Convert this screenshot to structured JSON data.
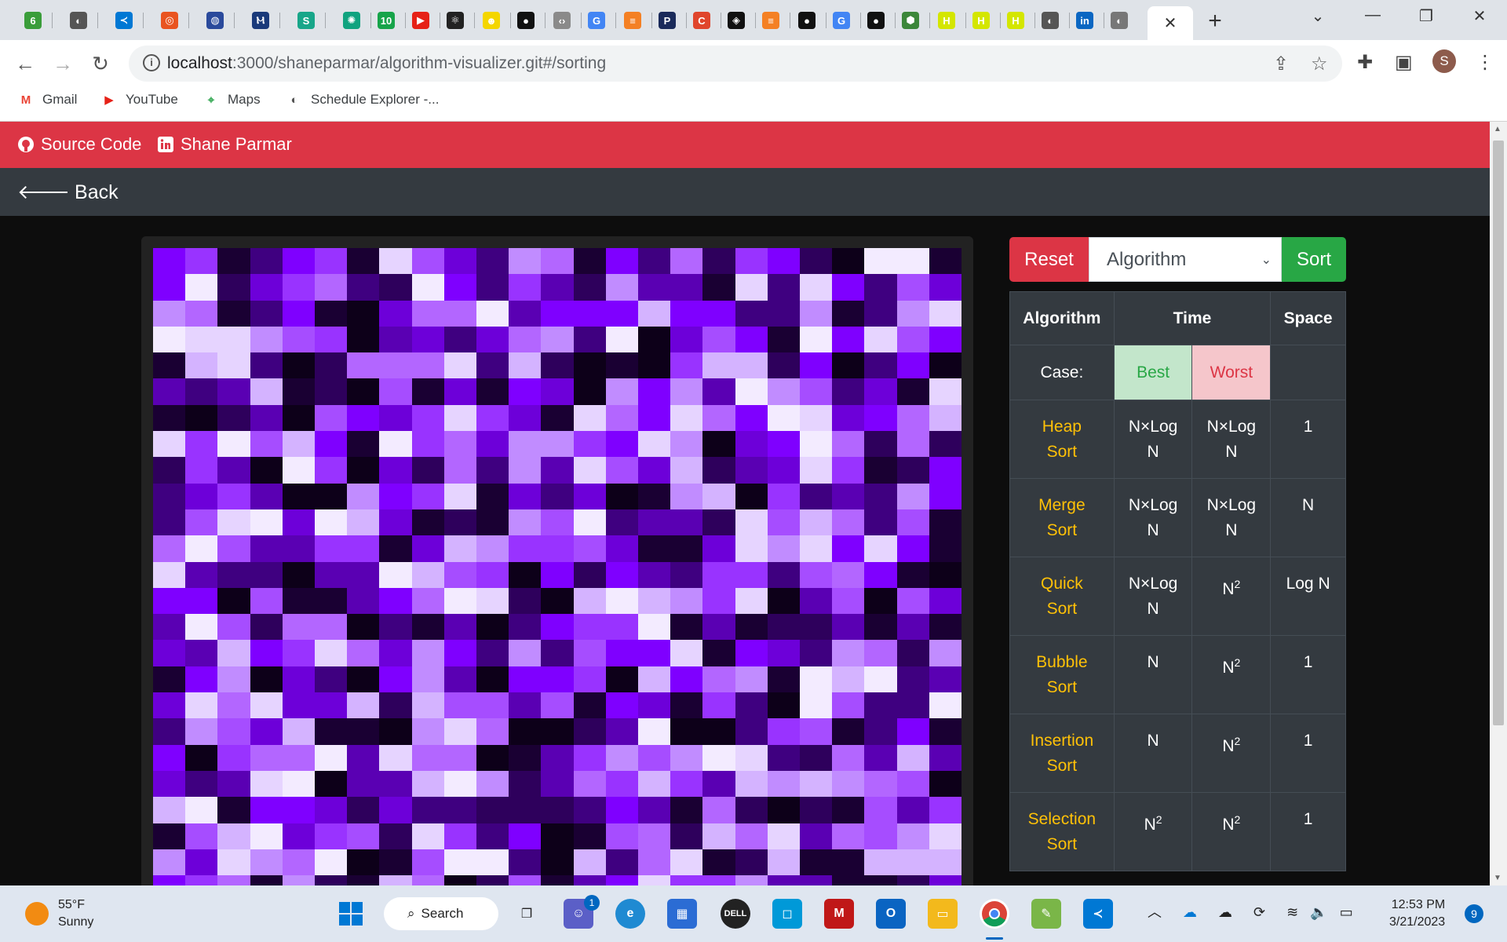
{
  "browser": {
    "tabs": [
      {
        "icon": "leaf-icon",
        "glyph": "6",
        "color": "#3a9d3a"
      },
      {
        "icon": "globe-icon",
        "glyph": "◐",
        "color": "#555555"
      },
      {
        "icon": "vscode-icon",
        "glyph": "≺",
        "color": "#0078d4"
      },
      {
        "icon": "ubuntu-icon",
        "glyph": "◎",
        "color": "#e95420"
      },
      {
        "icon": "fingerprint-icon",
        "glyph": "◍",
        "color": "#2a4a9c"
      },
      {
        "icon": "mongo-icon",
        "glyph": "Ⲙ",
        "color": "#1a3a7a"
      },
      {
        "icon": "s-logo-icon",
        "glyph": "S",
        "color": "#18a689"
      },
      {
        "icon": "chatgpt-icon",
        "glyph": "✺",
        "color": "#10a37f"
      },
      {
        "icon": "badge-10-icon",
        "glyph": "10",
        "color": "#17a44a"
      },
      {
        "icon": "youtube-icon",
        "glyph": "▶",
        "color": "#e62117"
      },
      {
        "icon": "react-icon",
        "glyph": "⚛",
        "color": "#222222"
      },
      {
        "icon": "snapchat-icon",
        "glyph": "☻",
        "color": "#f4d600"
      },
      {
        "icon": "github-icon",
        "glyph": "●",
        "color": "#111111"
      },
      {
        "icon": "code-icon",
        "glyph": "‹›",
        "color": "#8a8a8a"
      },
      {
        "icon": "google-icon",
        "glyph": "G",
        "color": "#4285f4"
      },
      {
        "icon": "stackoverflow-icon",
        "glyph": "≡",
        "color": "#f48024"
      },
      {
        "icon": "p-logo-icon",
        "glyph": "P",
        "color": "#1a2a5a"
      },
      {
        "icon": "c-logo-icon",
        "glyph": "C",
        "color": "#e0452c"
      },
      {
        "icon": "codesandbox-icon",
        "glyph": "◈",
        "color": "#111111"
      },
      {
        "icon": "stackoverflow-icon",
        "glyph": "≡",
        "color": "#f48024"
      },
      {
        "icon": "github-icon",
        "glyph": "●",
        "color": "#111111"
      },
      {
        "icon": "google-icon",
        "glyph": "G",
        "color": "#4285f4"
      },
      {
        "icon": "github-icon",
        "glyph": "●",
        "color": "#111111"
      },
      {
        "icon": "node-icon",
        "glyph": "⬢",
        "color": "#3c873a"
      },
      {
        "icon": "h-logo-icon",
        "glyph": "H",
        "color": "#d4e600"
      },
      {
        "icon": "h-logo-icon",
        "glyph": "H",
        "color": "#d4e600"
      },
      {
        "icon": "h-logo-icon",
        "glyph": "H",
        "color": "#d4e600"
      },
      {
        "icon": "globe-icon",
        "glyph": "◐",
        "color": "#555555"
      },
      {
        "icon": "linkedin-icon",
        "glyph": "in",
        "color": "#0a66c2"
      },
      {
        "icon": "globe-icon",
        "glyph": "◐",
        "color": "#777777"
      }
    ],
    "active_tab_close": "✕",
    "new_tab": "+",
    "url_host": "localhost",
    "url_rest": ":3000/shaneparmar/algorithm-visualizer.git#/sorting",
    "profile_initial": "S",
    "bookmarks": [
      {
        "label": "Gmail",
        "icon": "gmail-icon",
        "glyph": "M",
        "color": "#ea4335"
      },
      {
        "label": "YouTube",
        "icon": "youtube-icon",
        "glyph": "▶",
        "color": "#e62117"
      },
      {
        "label": "Maps",
        "icon": "maps-icon",
        "glyph": "⌖",
        "color": "#34a853"
      },
      {
        "label": "Schedule Explorer -...",
        "icon": "globe-icon",
        "glyph": "◐",
        "color": "#555555"
      }
    ]
  },
  "app": {
    "nav": {
      "source_code": "Source Code",
      "author": "Shane Parmar"
    },
    "back_label": "Back",
    "controls": {
      "reset": "Reset",
      "algorithm_select": "Algorithm",
      "sort": "Sort"
    },
    "table": {
      "headers": [
        "Algorithm",
        "Time",
        "Space"
      ],
      "case_label": "Case:",
      "best_label": "Best",
      "worst_label": "Worst",
      "rows": [
        {
          "name": "Heap Sort",
          "best": "N×Log N",
          "worst": "N×Log N",
          "space": "1"
        },
        {
          "name": "Merge Sort",
          "best": "N×Log N",
          "worst": "N×Log N",
          "space": "N"
        },
        {
          "name": "Quick Sort",
          "best": "N×Log N",
          "worst": "N²",
          "space": "Log N"
        },
        {
          "name": "Bubble Sort",
          "best": "N",
          "worst": "N²",
          "space": "1"
        },
        {
          "name": "Insertion Sort",
          "best": "N",
          "worst": "N²",
          "space": "1"
        },
        {
          "name": "Selection Sort",
          "best": "N²",
          "worst": "N²",
          "space": "1"
        }
      ]
    },
    "colors": {
      "accent_red": "#dc3545",
      "accent_green": "#28a745",
      "algorithm_name": "#ffc107"
    }
  },
  "taskbar": {
    "weather_temp": "55°F",
    "weather_desc": "Sunny",
    "search_label": "Search",
    "chat_badge": "1",
    "time": "12:53 PM",
    "date": "3/21/2023",
    "notifications": "9"
  }
}
